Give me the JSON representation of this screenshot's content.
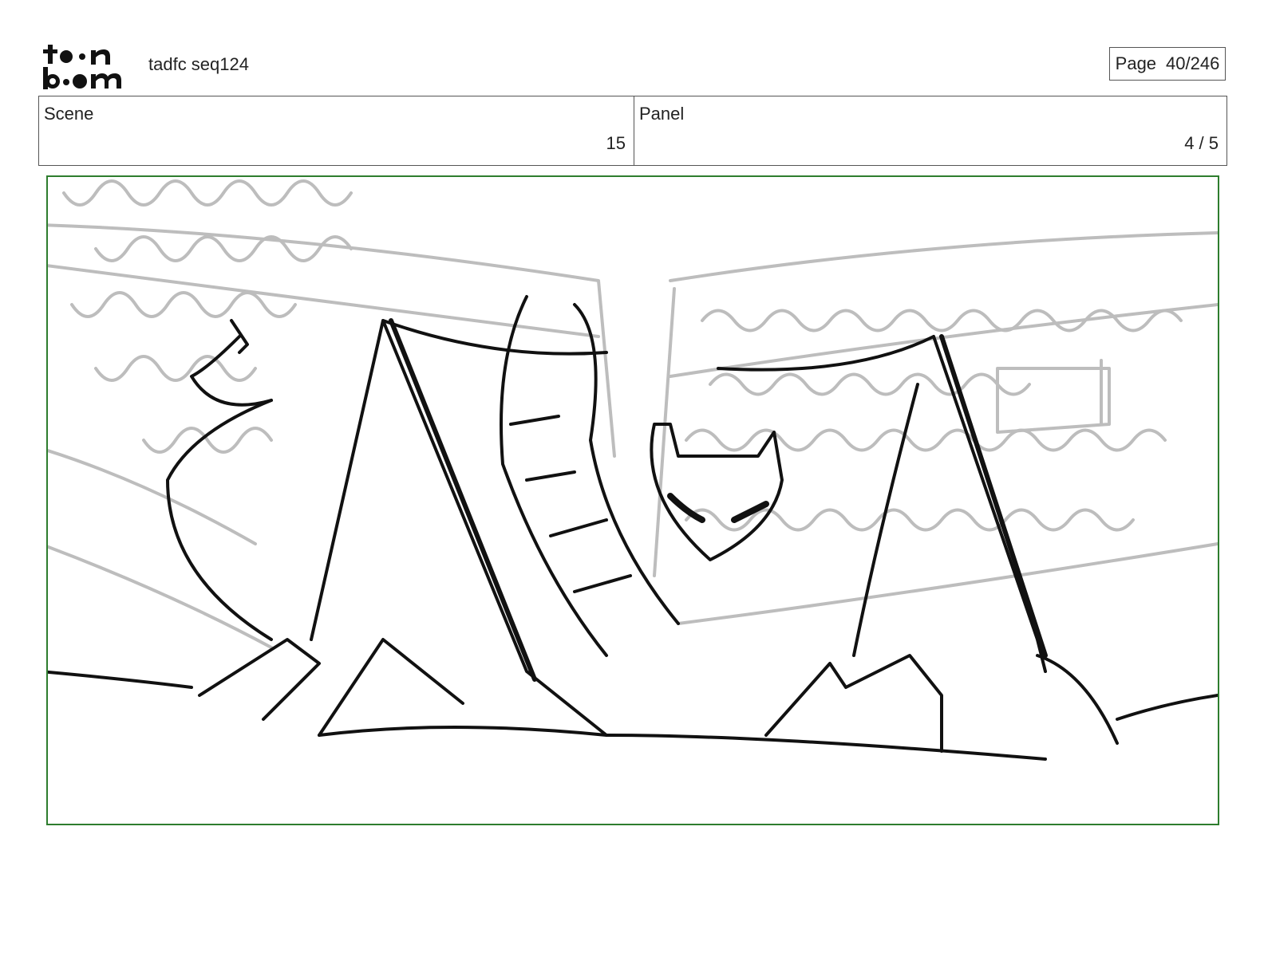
{
  "header": {
    "logo_text": "toonboom",
    "document_title": "tadfc seq124",
    "page_label": "Page",
    "page_value": "40/246"
  },
  "info": {
    "scene_label": "Scene",
    "scene_value": "15",
    "panel_label": "Panel",
    "panel_value": "4 / 5"
  },
  "colors": {
    "frame_border": "#2e7d2e",
    "ink": "#111111",
    "background_sketch": "#bdbdbd"
  },
  "panel_image": {
    "icon": "storyboard-sketch"
  }
}
